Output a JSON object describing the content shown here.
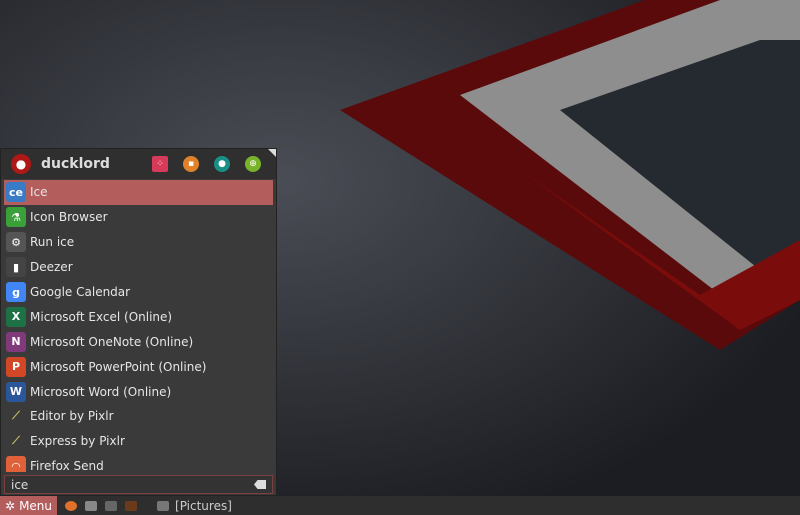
{
  "user": {
    "name": "ducklord"
  },
  "header_buttons": [
    {
      "name": "software-icon",
      "color": "#d83a5a"
    },
    {
      "name": "lock-icon",
      "color": "#e0822a"
    },
    {
      "name": "user-switch-icon",
      "color": "#1a8f86"
    },
    {
      "name": "logout-icon",
      "color": "#7ab22a"
    }
  ],
  "items": [
    {
      "label": "Ice",
      "icon": "ice-icon",
      "color": "#3a7bc8",
      "glyph": "ce"
    },
    {
      "label": "Icon Browser",
      "icon": "flask-icon",
      "color": "#3aa03a",
      "glyph": "⚗"
    },
    {
      "label": "Run ice",
      "icon": "gears-icon",
      "color": "#555",
      "glyph": "⚙"
    },
    {
      "label": "Deezer",
      "icon": "deezer-icon",
      "color": "#444",
      "glyph": "▮"
    },
    {
      "label": "Google Calendar",
      "icon": "google-icon",
      "color": "#4285f4",
      "glyph": "g"
    },
    {
      "label": "Microsoft Excel (Online)",
      "icon": "excel-icon",
      "color": "#1e7145",
      "glyph": "X"
    },
    {
      "label": "Microsoft OneNote (Online)",
      "icon": "onenote-icon",
      "color": "#80397b",
      "glyph": "N"
    },
    {
      "label": "Microsoft PowerPoint (Online)",
      "icon": "powerpoint-icon",
      "color": "#d24726",
      "glyph": "P"
    },
    {
      "label": "Microsoft Word (Online)",
      "icon": "word-icon",
      "color": "#2b579a",
      "glyph": "W"
    },
    {
      "label": "Editor by Pixlr",
      "icon": "pixlr-icon",
      "color": "transparent",
      "glyph": "⟋"
    },
    {
      "label": "Express by Pixlr",
      "icon": "pixlr-icon",
      "color": "transparent",
      "glyph": "⟋"
    },
    {
      "label": "Firefox Send",
      "icon": "firefox-send-icon",
      "color": "#e0603a",
      "glyph": "◠"
    }
  ],
  "search": {
    "value": "ice"
  },
  "taskbar": {
    "menu_label": "Menu",
    "window_label": "[Pictures]"
  }
}
